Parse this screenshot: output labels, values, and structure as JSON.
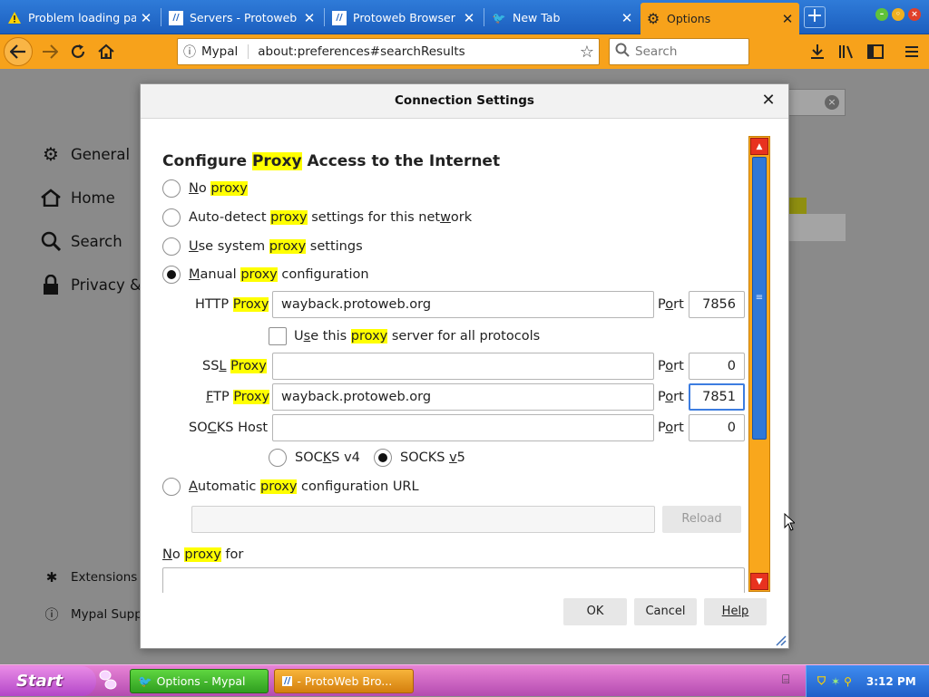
{
  "tabs": [
    {
      "title": "Problem loading pa…",
      "icon": "warning-icon"
    },
    {
      "title": "Servers - Protoweb",
      "icon": "protoweb-icon"
    },
    {
      "title": "Protoweb Browser",
      "icon": "protoweb-icon"
    },
    {
      "title": "New Tab",
      "icon": "mypal-icon"
    },
    {
      "title": "Options",
      "icon": "gear-icon",
      "active": true
    }
  ],
  "toolbar": {
    "identity_label": "Mypal",
    "url": "about:preferences#searchResults",
    "search_placeholder": "Search"
  },
  "prefs_sidebar": {
    "items": [
      "General",
      "Home",
      "Search",
      "Privacy & S"
    ],
    "extensions": "Extensions &",
    "support": "Mypal Suppo"
  },
  "dialog": {
    "title": "Connection Settings",
    "heading": {
      "pre": "Configure ",
      "hl": "Proxy",
      "post": " Access to the Internet"
    },
    "options": {
      "no_proxy": {
        "u": "N",
        "pre": "o ",
        "hl": "proxy",
        "post": ""
      },
      "auto_detect": {
        "pre": "Auto-detect ",
        "hl": "proxy",
        "post1": " settings for this net",
        "u": "w",
        "post2": "ork"
      },
      "system": {
        "u": "U",
        "pre": "se system ",
        "hl": "proxy",
        "post": " settings"
      },
      "manual": {
        "u": "M",
        "pre": "anual ",
        "hl": "proxy",
        "post": " configuration"
      },
      "auto_url": {
        "u": "A",
        "pre": "utomatic ",
        "hl": "proxy",
        "post": " configuration URL"
      }
    },
    "http": {
      "label_pre": "HTTP ",
      "hl": "Proxy",
      "value": "wayback.protoweb.org",
      "port": "7856"
    },
    "share_checkbox": {
      "pre": "U",
      "u": "s",
      "post1": "e this ",
      "hl": "proxy",
      "post2": " server for all protocols"
    },
    "ssl": {
      "label_pre": "SS",
      "u": "L",
      "hl": "Proxy",
      "value": "",
      "port": "0"
    },
    "ftp": {
      "u": "F",
      "label_pre": "TP ",
      "hl": "Proxy",
      "value": "wayback.protoweb.org",
      "port": "7851"
    },
    "socks": {
      "label_pre": "SO",
      "u": "C",
      "label_post": "KS Host",
      "value": "",
      "port": "0"
    },
    "port_label": {
      "pre": "P",
      "u": "o",
      "post": "rt"
    },
    "socks_v4": {
      "pre": "SOC",
      "u": "K",
      "post": "S v4"
    },
    "socks_v5": {
      "pre": "SOCKS ",
      "u": "v",
      "post": "5"
    },
    "reload_label": "Reload",
    "no_proxy_for": {
      "u": "N",
      "pre": "o ",
      "hl": "proxy",
      "post": " for"
    },
    "ok_label": "OK",
    "cancel_label": "Cancel",
    "help_label": "Help"
  },
  "taskbar": {
    "start_label": "Start",
    "tasks": [
      "Options - Mypal",
      "- ProtoWeb Bro..."
    ],
    "clock": "3:12 PM"
  }
}
